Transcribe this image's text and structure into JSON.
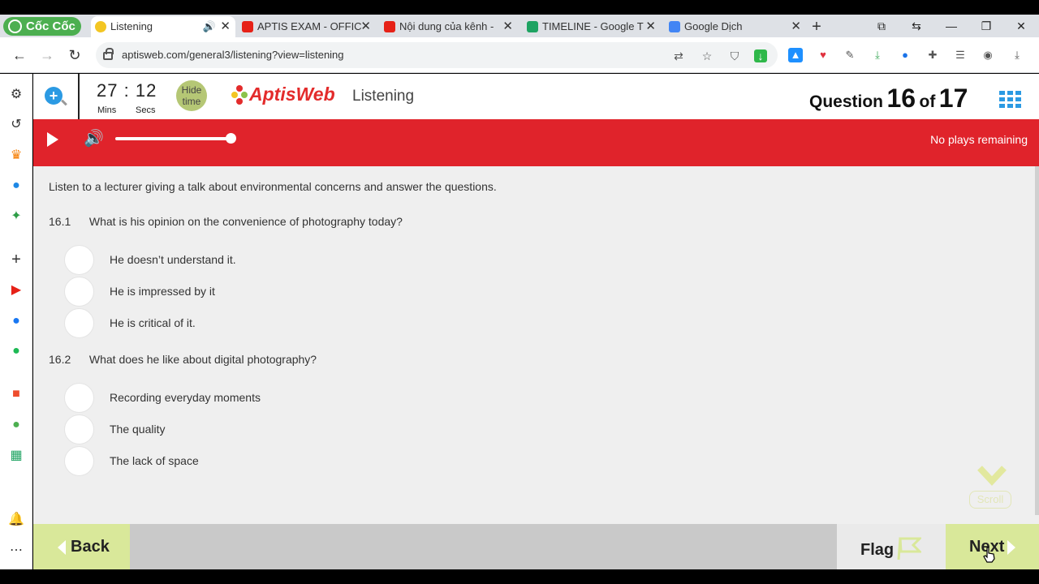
{
  "browser": {
    "brand": "Cốc Cốc",
    "tabs": [
      {
        "title": "Listening",
        "active": true
      },
      {
        "title": "APTIS EXAM - OFFIC"
      },
      {
        "title": "Nội dung của kênh -"
      },
      {
        "title": "TIMELINE - Google T"
      },
      {
        "title": "Google Dịch"
      }
    ],
    "url": "aptisweb.com/general3/listening?view=listening"
  },
  "header": {
    "timer_minutes": "27",
    "timer_seconds": "12",
    "timer_sep": ":",
    "mins_label": "Mins",
    "secs_label": "Secs",
    "hide_time_label_1": "Hide",
    "hide_time_label_2": "time",
    "logo_text": "AptisWeb",
    "section_title": "Listening",
    "question_word": "Question",
    "question_current": "16",
    "of_word": "of",
    "question_total": "17"
  },
  "player": {
    "plays_status": "No plays remaining",
    "volume_level": 1.0
  },
  "content": {
    "instruction": "Listen to a lecturer giving a talk about environmental concerns and answer the questions.",
    "questions": [
      {
        "number": "16.1",
        "text": "What is his opinion on the convenience of photography today?",
        "options": [
          "He doesn’t understand it.",
          "He is impressed by it",
          "He is critical of it."
        ]
      },
      {
        "number": "16.2",
        "text": "What does he like about digital photography?",
        "options": [
          "Recording everyday moments",
          "The quality",
          "The lack of space"
        ]
      }
    ],
    "scroll_label": "Scroll"
  },
  "footer": {
    "back_label": "Back",
    "flag_label": "Flag",
    "next_label": "Next"
  },
  "colors": {
    "accent_red": "#e0232b",
    "lime": "#d9e89a",
    "blue": "#2b9ae3"
  }
}
